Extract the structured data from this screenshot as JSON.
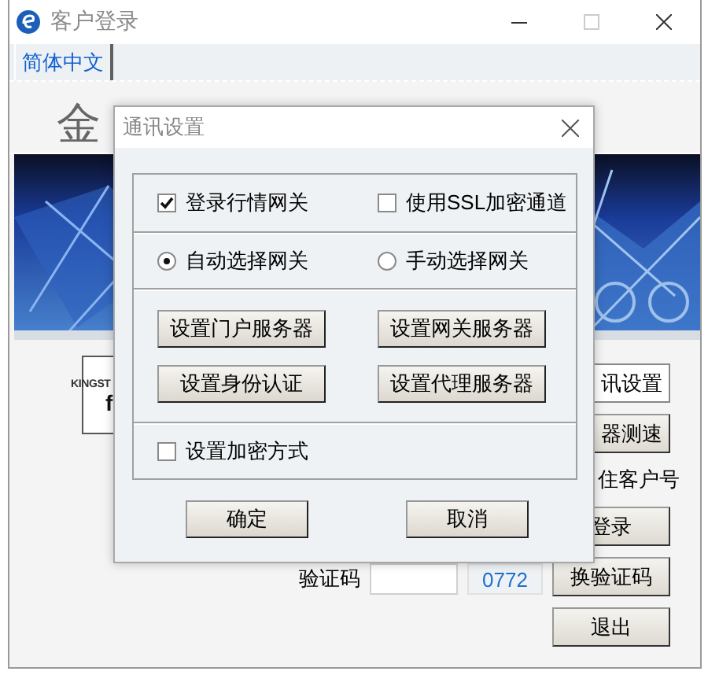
{
  "window": {
    "title": "客户登录"
  },
  "language_tab": {
    "label": "简体中文",
    "selected": true
  },
  "header": {
    "brand": "金"
  },
  "logo": {
    "text": "KINGST",
    "subtext": "f"
  },
  "side_items": [
    {
      "kind": "button",
      "label": "讯设置",
      "focused": true
    },
    {
      "kind": "button",
      "label": "器测速",
      "focused": false
    },
    {
      "kind": "text",
      "label": "住客户号"
    },
    {
      "kind": "button",
      "label": "登录",
      "focused": false
    },
    {
      "kind": "button",
      "label": "换验证码",
      "focused": false
    },
    {
      "kind": "button",
      "label": "退出",
      "focused": false
    }
  ],
  "captcha": {
    "label": "验证码",
    "code": "0772"
  },
  "dialog": {
    "title": "通讯设置",
    "options": [
      {
        "label": "登录行情网关",
        "checked": true
      },
      {
        "label": "使用SSL加密通道",
        "checked": false
      }
    ],
    "gateway_mode": [
      {
        "label": "自动选择网关",
        "selected": true
      },
      {
        "label": "手动选择网关",
        "selected": false
      }
    ],
    "server_buttons": [
      "设置门户服务器",
      "设置网关服务器",
      "设置身份认证",
      "设置代理服务器"
    ],
    "encryption": {
      "label": "设置加密方式",
      "checked": false
    },
    "buttons": [
      "确定",
      "取消"
    ]
  }
}
